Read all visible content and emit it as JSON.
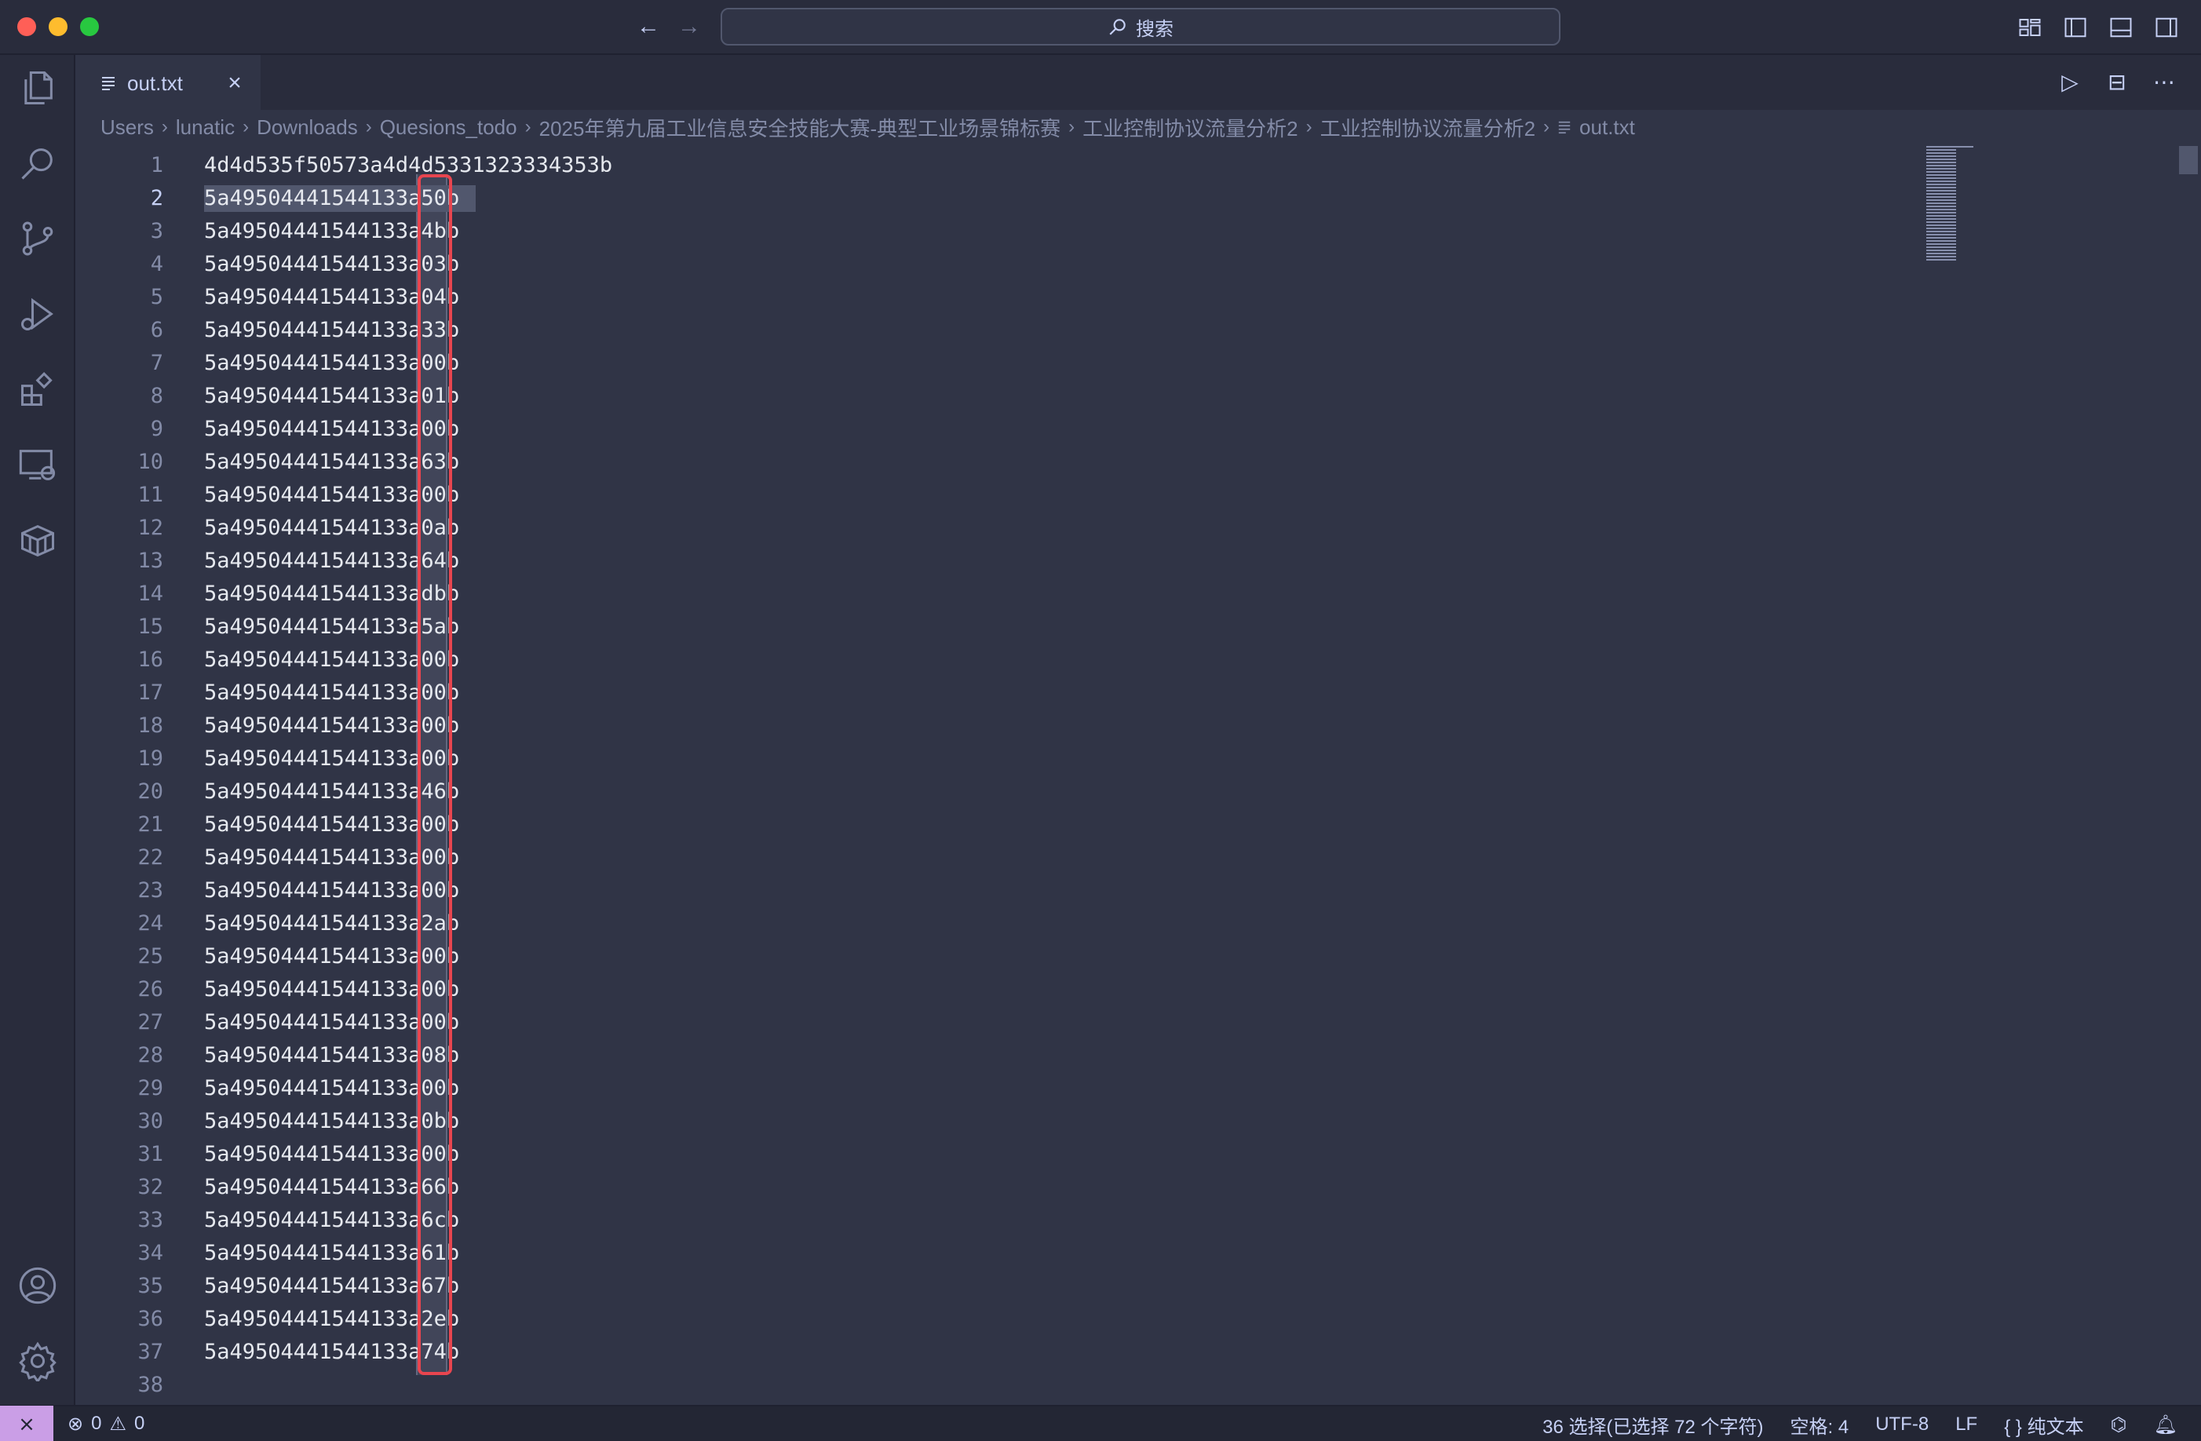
{
  "titlebar": {
    "search_label": "搜索"
  },
  "tab": {
    "label": "out.txt"
  },
  "breadcrumb": [
    "Users",
    "lunatic",
    "Downloads",
    "Quesions_todo",
    "2025年第九届工业信息安全技能大赛-典型工业场景锦标赛",
    "工业控制协议流量分析2",
    "工业控制协议流量分析2",
    "out.txt"
  ],
  "editor": {
    "lines": [
      {
        "n": "1",
        "text": "4d4d535f50573a4d4d5331323334353b"
      },
      {
        "n": "2",
        "text": "5a49504441544133a50b"
      },
      {
        "n": "3",
        "text": "5a49504441544133a4bb"
      },
      {
        "n": "4",
        "text": "5a49504441544133a03b"
      },
      {
        "n": "5",
        "text": "5a49504441544133a04b"
      },
      {
        "n": "6",
        "text": "5a49504441544133a33b"
      },
      {
        "n": "7",
        "text": "5a49504441544133a00b"
      },
      {
        "n": "8",
        "text": "5a49504441544133a01b"
      },
      {
        "n": "9",
        "text": "5a49504441544133a00b"
      },
      {
        "n": "10",
        "text": "5a49504441544133a63b"
      },
      {
        "n": "11",
        "text": "5a49504441544133a00b"
      },
      {
        "n": "12",
        "text": "5a49504441544133a0ab"
      },
      {
        "n": "13",
        "text": "5a49504441544133a64b"
      },
      {
        "n": "14",
        "text": "5a49504441544133adbb"
      },
      {
        "n": "15",
        "text": "5a49504441544133a5ab"
      },
      {
        "n": "16",
        "text": "5a49504441544133a00b"
      },
      {
        "n": "17",
        "text": "5a49504441544133a00b"
      },
      {
        "n": "18",
        "text": "5a49504441544133a00b"
      },
      {
        "n": "19",
        "text": "5a49504441544133a00b"
      },
      {
        "n": "20",
        "text": "5a49504441544133a46b"
      },
      {
        "n": "21",
        "text": "5a49504441544133a00b"
      },
      {
        "n": "22",
        "text": "5a49504441544133a00b"
      },
      {
        "n": "23",
        "text": "5a49504441544133a00b"
      },
      {
        "n": "24",
        "text": "5a49504441544133a2ab"
      },
      {
        "n": "25",
        "text": "5a49504441544133a00b"
      },
      {
        "n": "26",
        "text": "5a49504441544133a00b"
      },
      {
        "n": "27",
        "text": "5a49504441544133a00b"
      },
      {
        "n": "28",
        "text": "5a49504441544133a08b"
      },
      {
        "n": "29",
        "text": "5a49504441544133a00b"
      },
      {
        "n": "30",
        "text": "5a49504441544133a0bb"
      },
      {
        "n": "31",
        "text": "5a49504441544133a00b"
      },
      {
        "n": "32",
        "text": "5a49504441544133a66b"
      },
      {
        "n": "33",
        "text": "5a49504441544133a6cb"
      },
      {
        "n": "34",
        "text": "5a49504441544133a61b"
      },
      {
        "n": "35",
        "text": "5a49504441544133a67b"
      },
      {
        "n": "36",
        "text": "5a49504441544133a2eb"
      },
      {
        "n": "37",
        "text": "5a49504441544133a74b"
      },
      {
        "n": "38",
        "text": ""
      }
    ]
  },
  "statusbar": {
    "errors": "0",
    "warnings": "0",
    "selection": "36 选择(已选择 72 个字符)",
    "spaces": "空格: 4",
    "encoding": "UTF-8",
    "eol": "LF",
    "language": "纯文本"
  },
  "colors": {
    "accent": "#ca9ee6",
    "highlight_box": "#e8454f",
    "editor_bg": "#303446"
  },
  "icons": [
    "explorer-icon",
    "search-icon",
    "source-control-icon",
    "run-debug-icon",
    "extensions-icon",
    "remote-explorer-icon",
    "packages-icon",
    "account-icon",
    "settings-gear-icon"
  ]
}
